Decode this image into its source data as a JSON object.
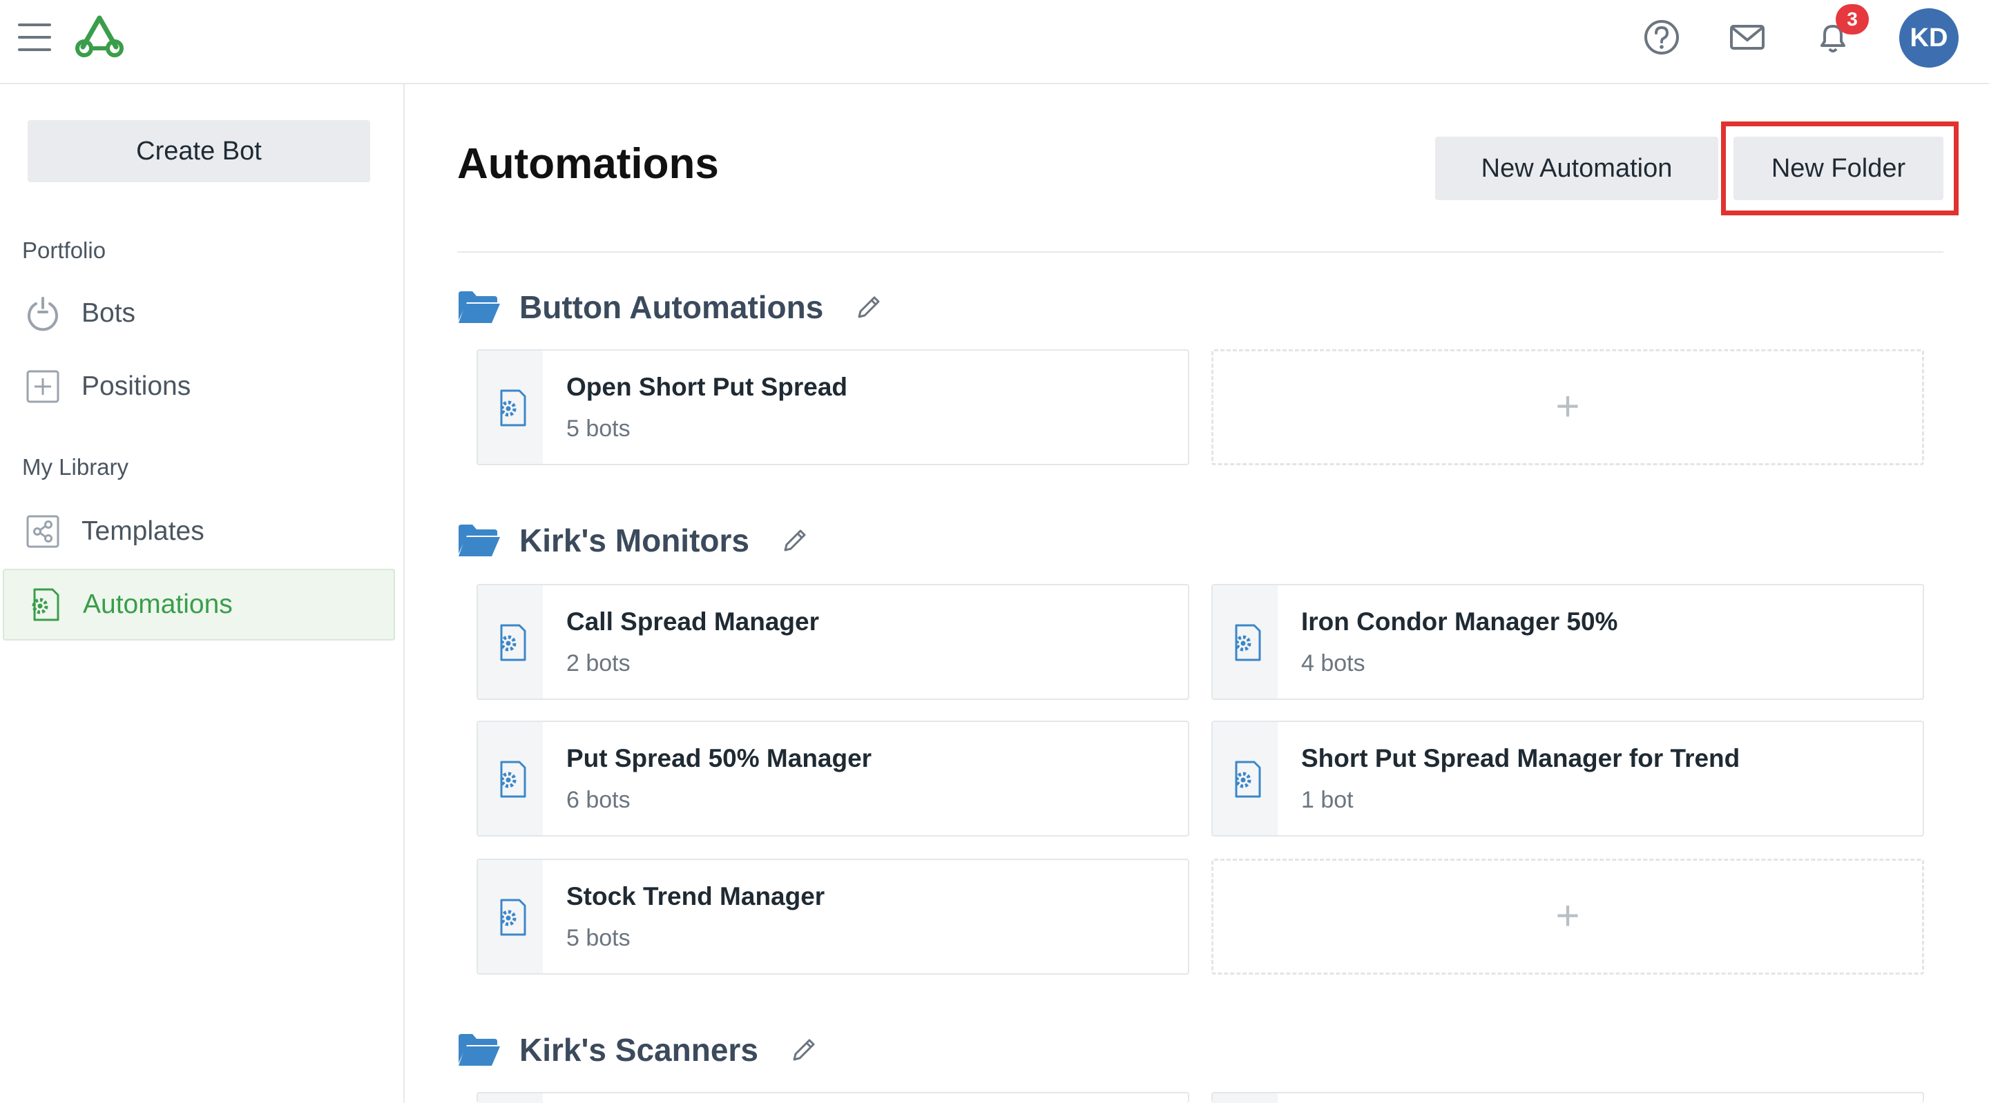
{
  "header": {
    "notification_count": "3",
    "avatar_initials": "KD",
    "brand_color": "#3a9d4a",
    "avatar_color": "#3d6fb0",
    "badge_color": "#e5393f"
  },
  "sidebar": {
    "create_bot_label": "Create Bot",
    "sections": [
      {
        "label": "Portfolio",
        "items": [
          {
            "label": "Bots",
            "icon": "power-icon"
          },
          {
            "label": "Positions",
            "icon": "plus-square-icon"
          }
        ]
      },
      {
        "label": "My Library",
        "items": [
          {
            "label": "Templates",
            "icon": "share-icon"
          },
          {
            "label": "Automations",
            "icon": "gear-doc-icon",
            "active": true
          }
        ]
      }
    ]
  },
  "main": {
    "title": "Automations",
    "new_automation_label": "New Automation",
    "new_folder_label": "New Folder",
    "highlight_color": "#e0322f",
    "add_symbol": "+",
    "folders": [
      {
        "name": "Button Automations",
        "cards": [
          {
            "name": "Open Short Put Spread",
            "count": "5 bots"
          }
        ]
      },
      {
        "name": "Kirk's Monitors",
        "cards": [
          {
            "name": "Call Spread Manager",
            "count": "2 bots"
          },
          {
            "name": "Iron Condor Manager 50%",
            "count": "4 bots"
          },
          {
            "name": "Put Spread 50% Manager",
            "count": "6 bots"
          },
          {
            "name": "Short Put Spread Manager for Trend",
            "count": "1 bot"
          },
          {
            "name": "Stock Trend Manager",
            "count": "5 bots"
          }
        ]
      },
      {
        "name": "Kirk's Scanners",
        "cards": []
      }
    ]
  }
}
